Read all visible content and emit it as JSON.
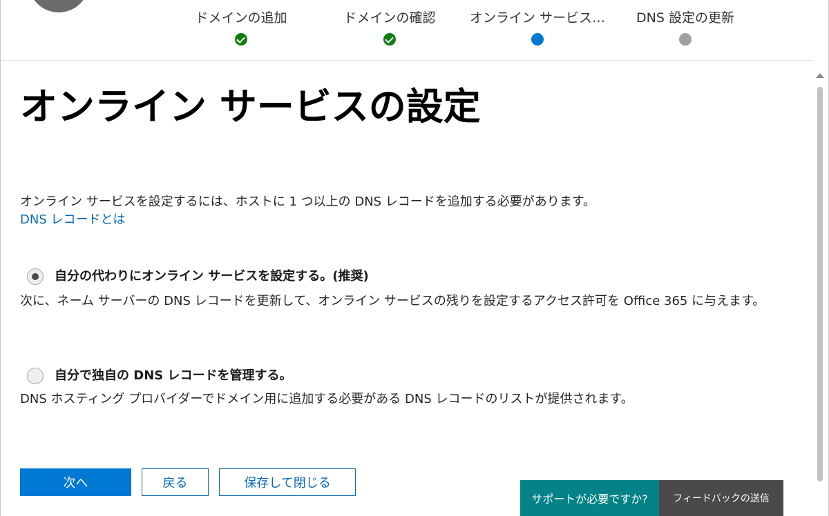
{
  "stepper": {
    "steps": [
      {
        "label": "ドメインの追加",
        "status": "completed"
      },
      {
        "label": "ドメインの確認",
        "status": "completed"
      },
      {
        "label": "オンライン サービス…",
        "status": "current"
      },
      {
        "label": "DNS 設定の更新",
        "status": "pending"
      }
    ],
    "colors": {
      "completed": "#107c10",
      "current": "#0078d4",
      "pending": "#a0a0a0"
    }
  },
  "main": {
    "title": "オンライン サービスの設定",
    "intro": "オンライン サービスを設定するには、ホストに 1 つ以上の DNS レコードを追加する必要があります。",
    "link": "DNS レコードとは",
    "options": [
      {
        "label": "自分の代わりにオンライン サービスを設定する。(推奨)",
        "description": "次に、ネーム サーバーの DNS レコードを更新して、オンライン サービスの残りを設定するアクセス許可を Office 365 に与えます。",
        "selected": true
      },
      {
        "label": "自分で独自の DNS レコードを管理する。",
        "description": "DNS ホスティング プロバイダーでドメイン用に追加する必要がある DNS レコードのリストが提供されます。",
        "selected": false
      }
    ]
  },
  "actions": {
    "next_label": "次へ",
    "back_label": "戻る",
    "save_close_label": "保存して閉じる"
  },
  "footer": {
    "support_label": "サポートが必要ですか?",
    "feedback_label": "フィードバックの送信"
  },
  "colors": {
    "accent": "#0078d4",
    "link": "#0b6ab4",
    "support_bg": "#038387",
    "feedback_bg": "#4a4a4a"
  }
}
